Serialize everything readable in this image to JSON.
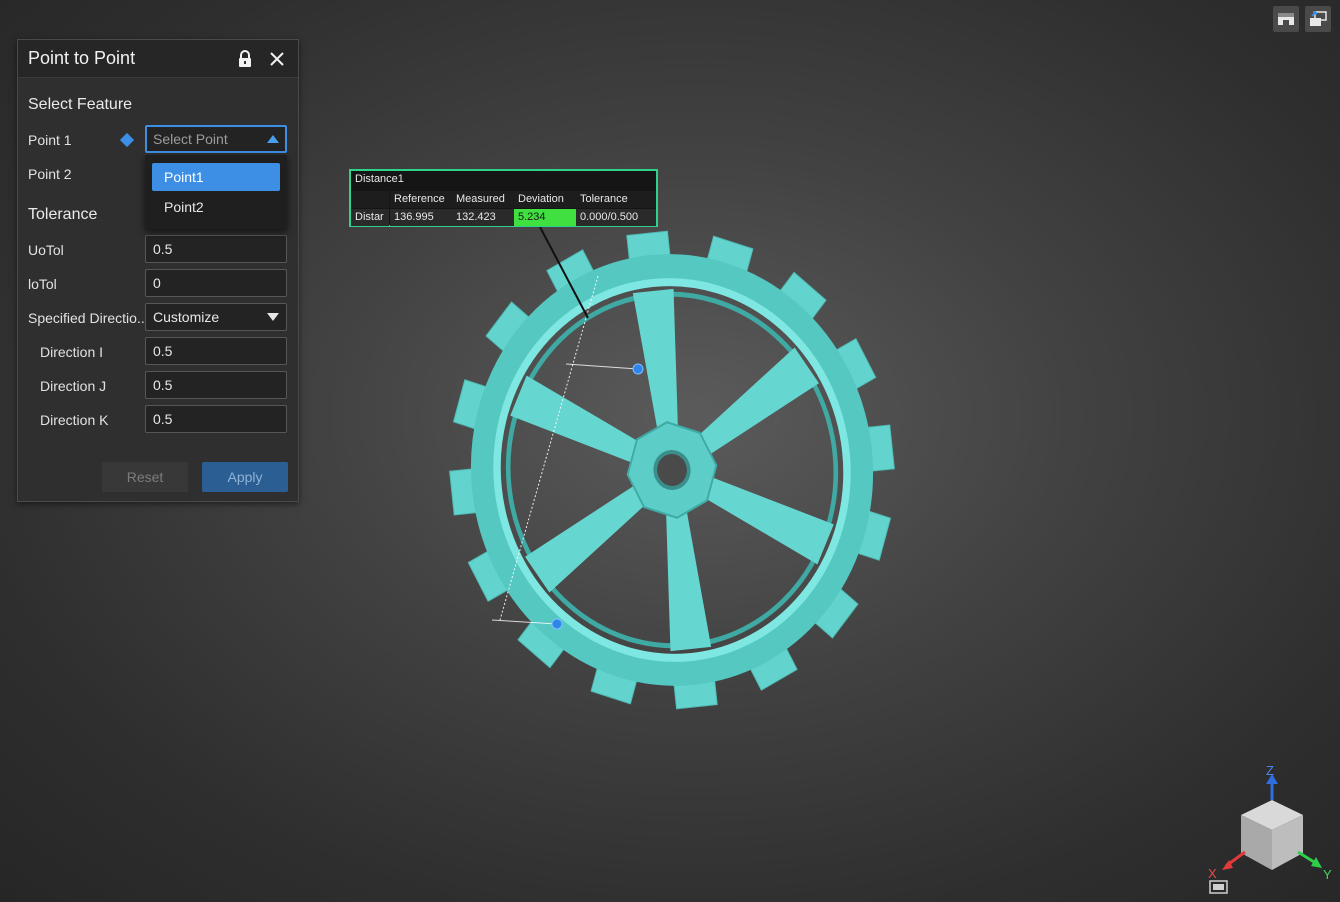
{
  "panel": {
    "title": "Point to Point",
    "lock_icon": "lock-icon",
    "close_icon": "close-icon",
    "select_feature": {
      "title": "Select Feature",
      "point1_label": "Point 1",
      "point1_placeholder": "Select Point",
      "point2_label": "Point 2",
      "dropdown_options": [
        "Point1",
        "Point2"
      ],
      "selected_option": "Point1"
    },
    "tolerance": {
      "title": "Tolerance",
      "uotol_label": "UoTol",
      "uotol_value": "0.5",
      "lotol_label": "loTol",
      "lotol_value": "0",
      "direction_label": "Specified Directio..",
      "direction_value": "Customize",
      "dir_i_label": "Direction I",
      "dir_i_value": "0.5",
      "dir_j_label": "Direction J",
      "dir_j_value": "0.5",
      "dir_k_label": "Direction K",
      "dir_k_value": "0.5"
    },
    "reset_label": "Reset",
    "apply_label": "Apply"
  },
  "measurement": {
    "title": "Distance1",
    "headers": [
      "Reference",
      "Measured",
      "Deviation",
      "Tolerance"
    ],
    "row_label": "Distar",
    "reference": "136.995",
    "measured": "132.423",
    "deviation": "5.234",
    "tolerance": "0.000/0.500",
    "deviation_color": "#3fe03f",
    "border_color": "#2fd28a"
  },
  "axes": {
    "z": "Z",
    "x": "X",
    "y": "Y"
  },
  "colors": {
    "accent": "#3d8fe6",
    "gear": "#6fdcd6"
  }
}
